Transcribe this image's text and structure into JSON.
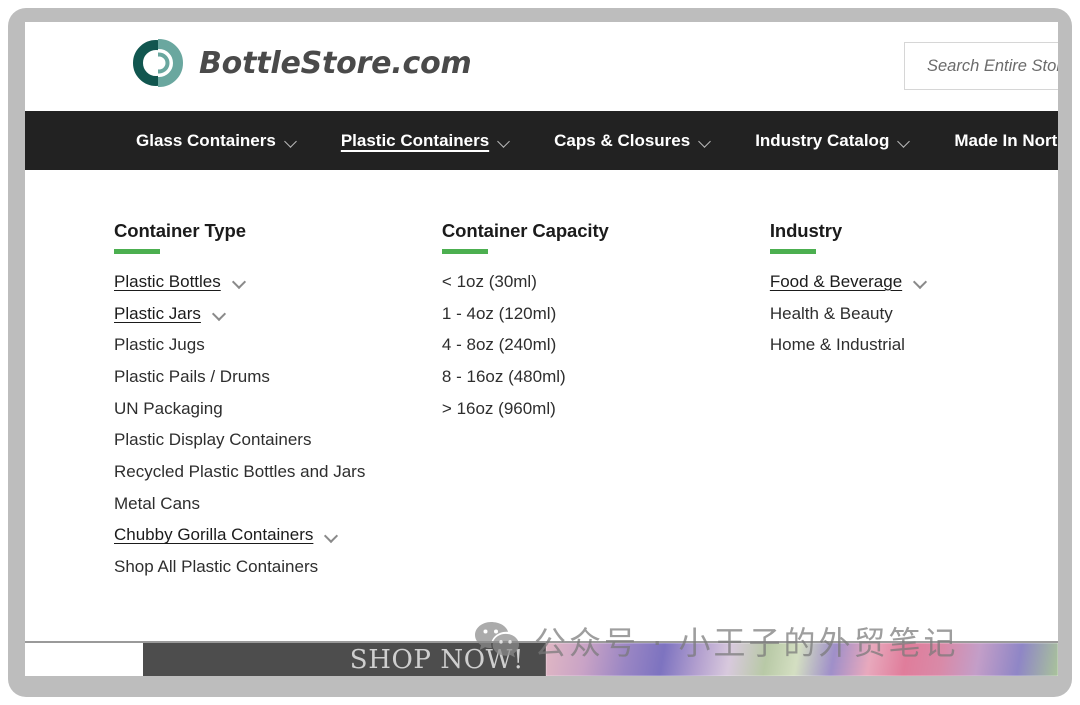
{
  "browser": {
    "frame_color": "#bdbdbd"
  },
  "header": {
    "logo_text": "BottleStore.com",
    "logo_icon": "bottlestore-circle-logo",
    "logo_dark_color": "#11564f",
    "logo_light_color": "#6aa79f",
    "search": {
      "placeholder": "Search Entire Stor",
      "value": ""
    }
  },
  "nav": {
    "items": [
      {
        "label": "Glass Containers",
        "has_caret": true,
        "active": false
      },
      {
        "label": "Plastic Containers",
        "has_caret": true,
        "active": true
      },
      {
        "label": "Caps & Closures",
        "has_caret": true,
        "active": false
      },
      {
        "label": "Industry Catalog",
        "has_caret": true,
        "active": false
      },
      {
        "label": "Made In Nort",
        "has_caret": false,
        "active": false
      }
    ]
  },
  "mega_menu": {
    "accent_color": "#4caf50",
    "columns": [
      {
        "title": "Container Type",
        "items": [
          {
            "label": "Plastic Bottles",
            "linked": true,
            "caret": true
          },
          {
            "label": "Plastic Jars",
            "linked": true,
            "caret": true
          },
          {
            "label": "Plastic Jugs",
            "linked": false,
            "caret": false
          },
          {
            "label": "Plastic Pails / Drums",
            "linked": false,
            "caret": false
          },
          {
            "label": "UN Packaging",
            "linked": false,
            "caret": false
          },
          {
            "label": "Plastic Display Containers",
            "linked": false,
            "caret": false
          },
          {
            "label": "Recycled Plastic Bottles and Jars",
            "linked": false,
            "caret": false
          },
          {
            "label": "Metal Cans",
            "linked": false,
            "caret": false
          },
          {
            "label": "Chubby Gorilla Containers",
            "linked": true,
            "caret": true
          },
          {
            "label": "Shop All Plastic Containers",
            "linked": false,
            "caret": false
          }
        ]
      },
      {
        "title": "Container Capacity",
        "items": [
          {
            "label": "< 1oz (30ml)",
            "linked": false,
            "caret": false
          },
          {
            "label": "1 - 4oz (120ml)",
            "linked": false,
            "caret": false
          },
          {
            "label": "4 - 8oz (240ml)",
            "linked": false,
            "caret": false
          },
          {
            "label": "8 - 16oz (480ml)",
            "linked": false,
            "caret": false
          },
          {
            "label": "> 16oz (960ml)",
            "linked": false,
            "caret": false
          }
        ]
      },
      {
        "title": "Industry",
        "items": [
          {
            "label": "Food & Beverage",
            "linked": true,
            "caret": true
          },
          {
            "label": "Health & Beauty",
            "linked": false,
            "caret": false
          },
          {
            "label": "Home & Industrial",
            "linked": false,
            "caret": false
          }
        ]
      }
    ]
  },
  "promo": {
    "shop_now_label": "SHOP NOW!"
  },
  "watermark": {
    "text": "公众号 · 小王子的外贸笔记",
    "icon": "wechat-icon"
  }
}
